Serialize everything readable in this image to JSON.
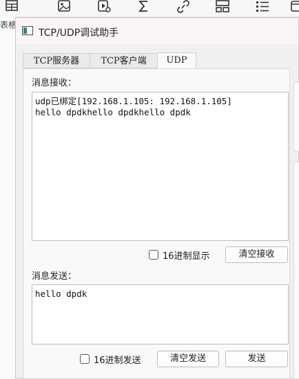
{
  "host": {
    "side_label": "表格",
    "ribbon_icons": [
      "table-icon",
      "image-icon",
      "media-icon",
      "sum-icon",
      "link-icon",
      "layout-icon",
      "list-icon",
      "window-icon"
    ]
  },
  "window": {
    "title": "TCP/UDP调试助手",
    "tabs": [
      {
        "label": "TCP服务器",
        "active": false
      },
      {
        "label": "TCP客户端",
        "active": false
      },
      {
        "label": "UDP",
        "active": true
      }
    ]
  },
  "receive": {
    "label": "消息接收：",
    "content": "udp已绑定[192.168.1.105: 192.168.1.105]\nhello dpdkhello dpdkhello dpdk",
    "hex_label": "16进制显示",
    "hex_checked": false,
    "clear_label": "清空接收"
  },
  "send": {
    "label": "消息发送：",
    "content": "hello dpdk",
    "hex_label": "16进制发送",
    "hex_checked": false,
    "clear_label": "清空发送",
    "send_label": "发送"
  }
}
